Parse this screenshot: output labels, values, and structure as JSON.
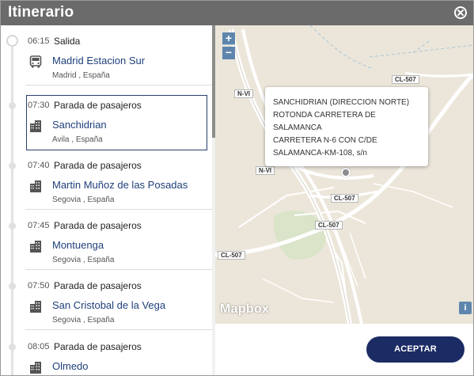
{
  "dialog": {
    "title": "Itinerario"
  },
  "stops": [
    {
      "time": "06:15",
      "type": "Salida",
      "name": "Madrid Estacion Sur",
      "location": "Madrid , España",
      "icon": "bus-icon"
    },
    {
      "time": "07:30",
      "type": "Parada de pasajeros",
      "name": "Sanchidrian",
      "location": "Avila , España",
      "icon": "building-icon"
    },
    {
      "time": "07:40",
      "type": "Parada de pasajeros",
      "name": "Martin Muñoz de las Posadas",
      "location": "Segovia , España",
      "icon": "building-icon"
    },
    {
      "time": "07:45",
      "type": "Parada de pasajeros",
      "name": "Montuenga",
      "location": "Segovia , España",
      "icon": "building-icon"
    },
    {
      "time": "07:50",
      "type": "Parada de pasajeros",
      "name": "San Cristobal de la Vega",
      "location": "Segovia , España",
      "icon": "building-icon"
    },
    {
      "time": "08:05",
      "type": "Parada de pasajeros",
      "name": "Olmedo",
      "location": "",
      "icon": "building-icon"
    }
  ],
  "map": {
    "zoom_in": "+",
    "zoom_out": "−",
    "info": "i",
    "logo": "Mapbox",
    "road_labels": [
      "N-VI",
      "CL-507",
      "N-VI",
      "CL-507",
      "CL-507",
      "CL-507"
    ],
    "popup_lines": [
      "SANCHIDRIAN (DIRECCION NORTE)",
      "ROTONDA CARRETERA DE",
      "SALAMANCA",
      "CARRETERA N-6 CON C/DE",
      "SALAMANCA-KM-108, s/n"
    ]
  },
  "actions": {
    "accept": "ACEPTAR"
  }
}
